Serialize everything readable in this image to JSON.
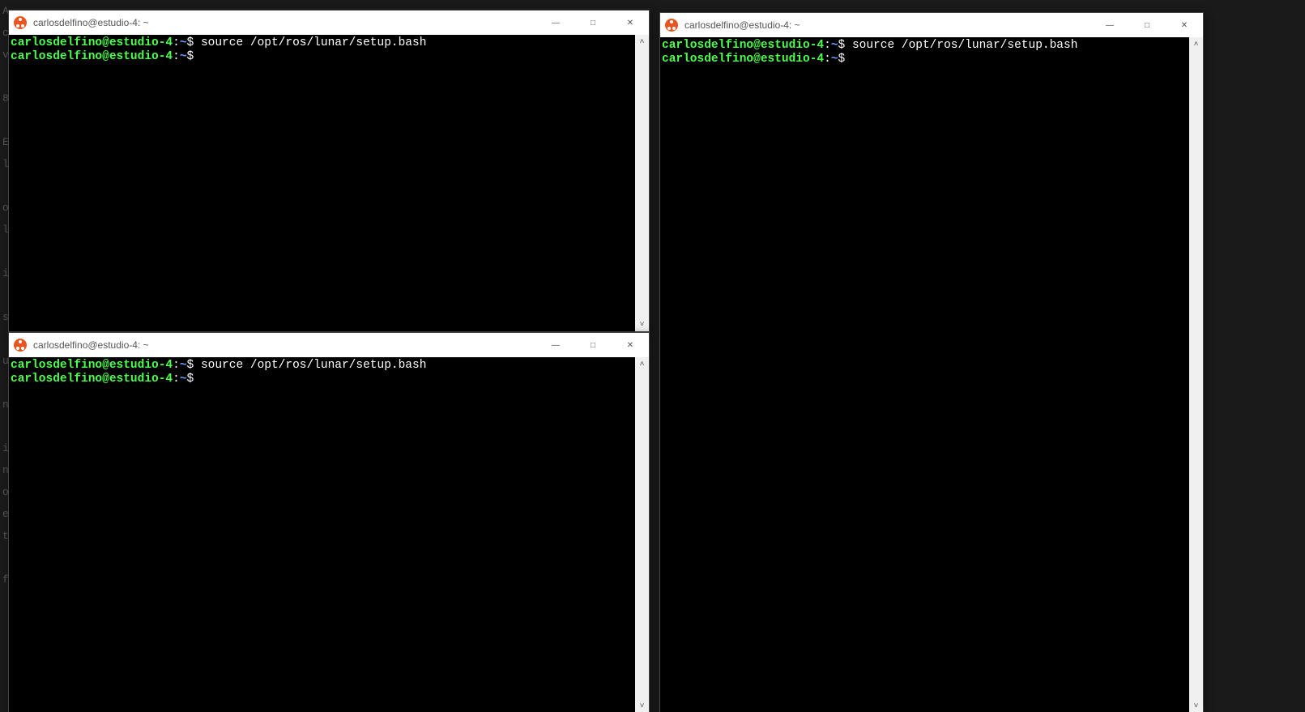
{
  "background_fragments": [
    "A",
    "c",
    "v",
    "",
    "8",
    "",
    "E",
    "l",
    "",
    "o",
    "l",
    "",
    "i",
    "",
    "s",
    "",
    "u",
    "",
    "n",
    "",
    "i",
    "n",
    "o",
    "e",
    "t",
    "",
    "f",
    ""
  ],
  "windows": [
    {
      "id": "win1",
      "title": "carlosdelfino@estudio-4: ~",
      "prompt_user": "carlosdelfino@estudio-4",
      "prompt_path": "~",
      "lines": [
        {
          "cmd": "source /opt/ros/lunar/setup.bash"
        },
        {
          "cmd": ""
        }
      ]
    },
    {
      "id": "win2",
      "title": "carlosdelfino@estudio-4: ~",
      "prompt_user": "carlosdelfino@estudio-4",
      "prompt_path": "~",
      "lines": [
        {
          "cmd": "source /opt/ros/lunar/setup.bash"
        },
        {
          "cmd": ""
        }
      ]
    },
    {
      "id": "win3",
      "title": "carlosdelfino@estudio-4: ~",
      "prompt_user": "carlosdelfino@estudio-4",
      "prompt_path": "~",
      "lines": [
        {
          "cmd": "source /opt/ros/lunar/setup.bash"
        },
        {
          "cmd": ""
        }
      ]
    }
  ],
  "controls": {
    "minimize": "—",
    "maximize": "□",
    "close": "✕",
    "scroll_up": "˄",
    "scroll_down": "˅"
  }
}
